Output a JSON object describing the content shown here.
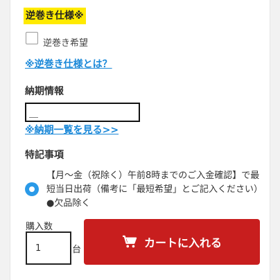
{
  "reverse_spec": {
    "title": "逆巻き仕様※",
    "checkbox_label": "逆巻き希望",
    "link_text": "※逆巻き仕様とは？"
  },
  "delivery": {
    "label": "納期情報",
    "input_value": "＿",
    "link_text": "※納期一覧を見る>>"
  },
  "notes": {
    "label": "特記事項",
    "option_text": "【月～金（祝除く）午前8時までのご入金確認】で最短当日出荷（備考に「最短希望」とご記入ください）●欠品除く"
  },
  "purchase": {
    "quantity_label": "購入数",
    "quantity_value": "1",
    "unit": "台",
    "cart_button_label": "カートに入れる",
    "cart_icon": "cart-icon"
  },
  "colors": {
    "highlight": "#ffea00",
    "link": "#1a88d8",
    "radio": "#2a9ae8",
    "cart_button": "#c81e1e"
  }
}
